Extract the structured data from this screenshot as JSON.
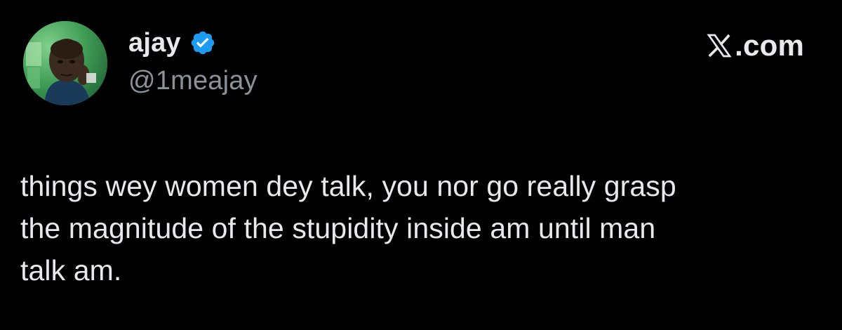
{
  "author": {
    "display_name": "ajay",
    "handle": "@1meajay",
    "verified": true,
    "avatar_icon": "profile-photo",
    "verified_color": "#1d9bf0"
  },
  "brand": {
    "icon": "x-logo-icon",
    "text": ".com"
  },
  "tweet": {
    "lines": [
      "things wey women dey talk, you nor go really grasp",
      "the magnitude of the stupidity inside am until man",
      "talk am."
    ]
  },
  "colors": {
    "background": "#000000",
    "text": "#e7e9ea",
    "secondary_text": "#8b9198"
  }
}
